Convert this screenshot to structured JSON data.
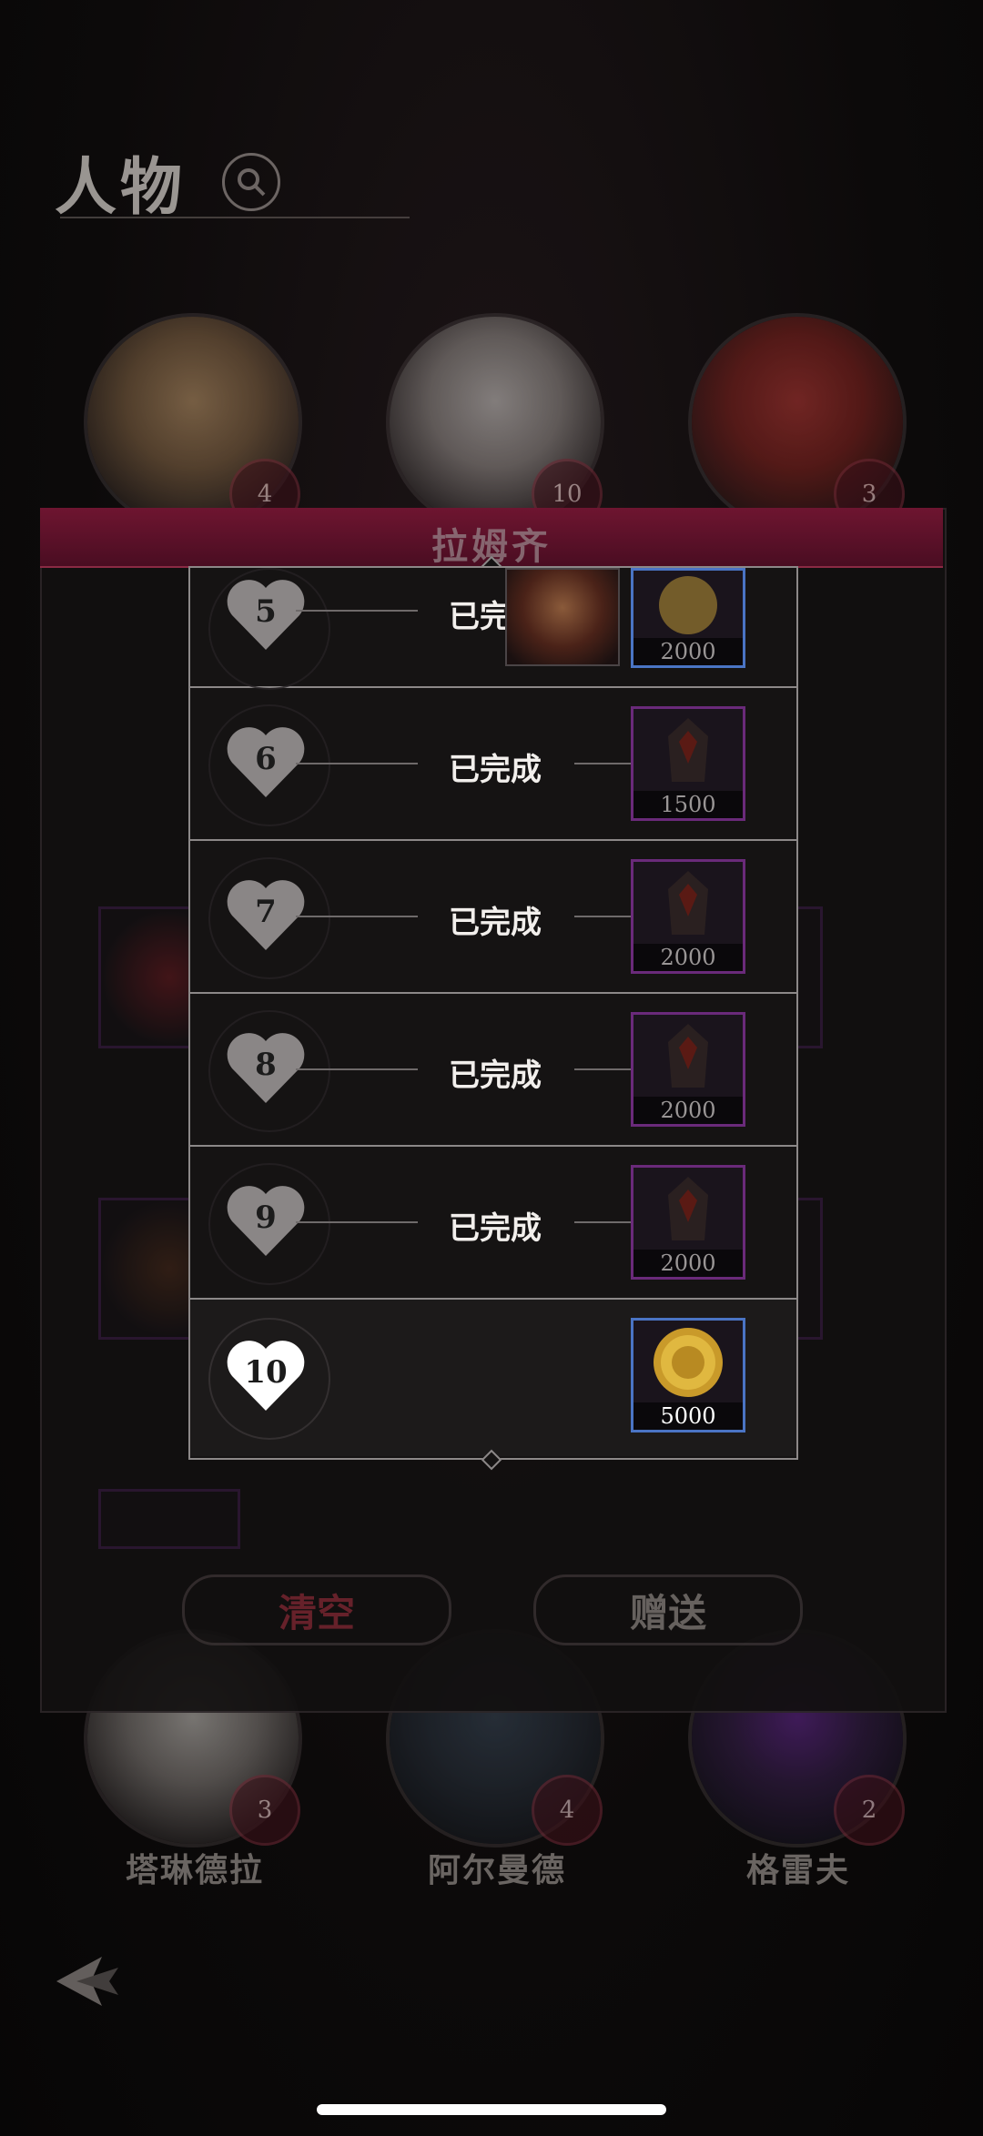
{
  "header": {
    "title": "人物"
  },
  "portraits_top": [
    {
      "level": "4"
    },
    {
      "level": "10"
    },
    {
      "level": "3"
    }
  ],
  "portraits_bottom": [
    {
      "name": "塔琳德拉",
      "level": "3"
    },
    {
      "name": "阿尔曼德",
      "level": "4"
    },
    {
      "name": "格雷夫",
      "level": "2"
    }
  ],
  "panel": {
    "title": "拉姆齐",
    "clear_label": "清空",
    "gift_label": "赠送"
  },
  "rewards": {
    "rows": [
      {
        "level": "5",
        "status": "已完成",
        "amount": "2000",
        "item": "gold-coin",
        "extra": "hero-portrait"
      },
      {
        "level": "6",
        "status": "已完成",
        "amount": "1500",
        "item": "dark-armor"
      },
      {
        "level": "7",
        "status": "已完成",
        "amount": "2000",
        "item": "dark-armor"
      },
      {
        "level": "8",
        "status": "已完成",
        "amount": "2000",
        "item": "dark-armor"
      },
      {
        "level": "9",
        "status": "已完成",
        "amount": "2000",
        "item": "dark-armor"
      },
      {
        "level": "10",
        "status": "",
        "amount": "5000",
        "item": "gold-coin"
      }
    ]
  },
  "colors": {
    "accent": "#6e1530",
    "reward_purple": "#6a2a7a",
    "reward_blue": "#4a74c4",
    "completed_text": "#f2efec"
  }
}
